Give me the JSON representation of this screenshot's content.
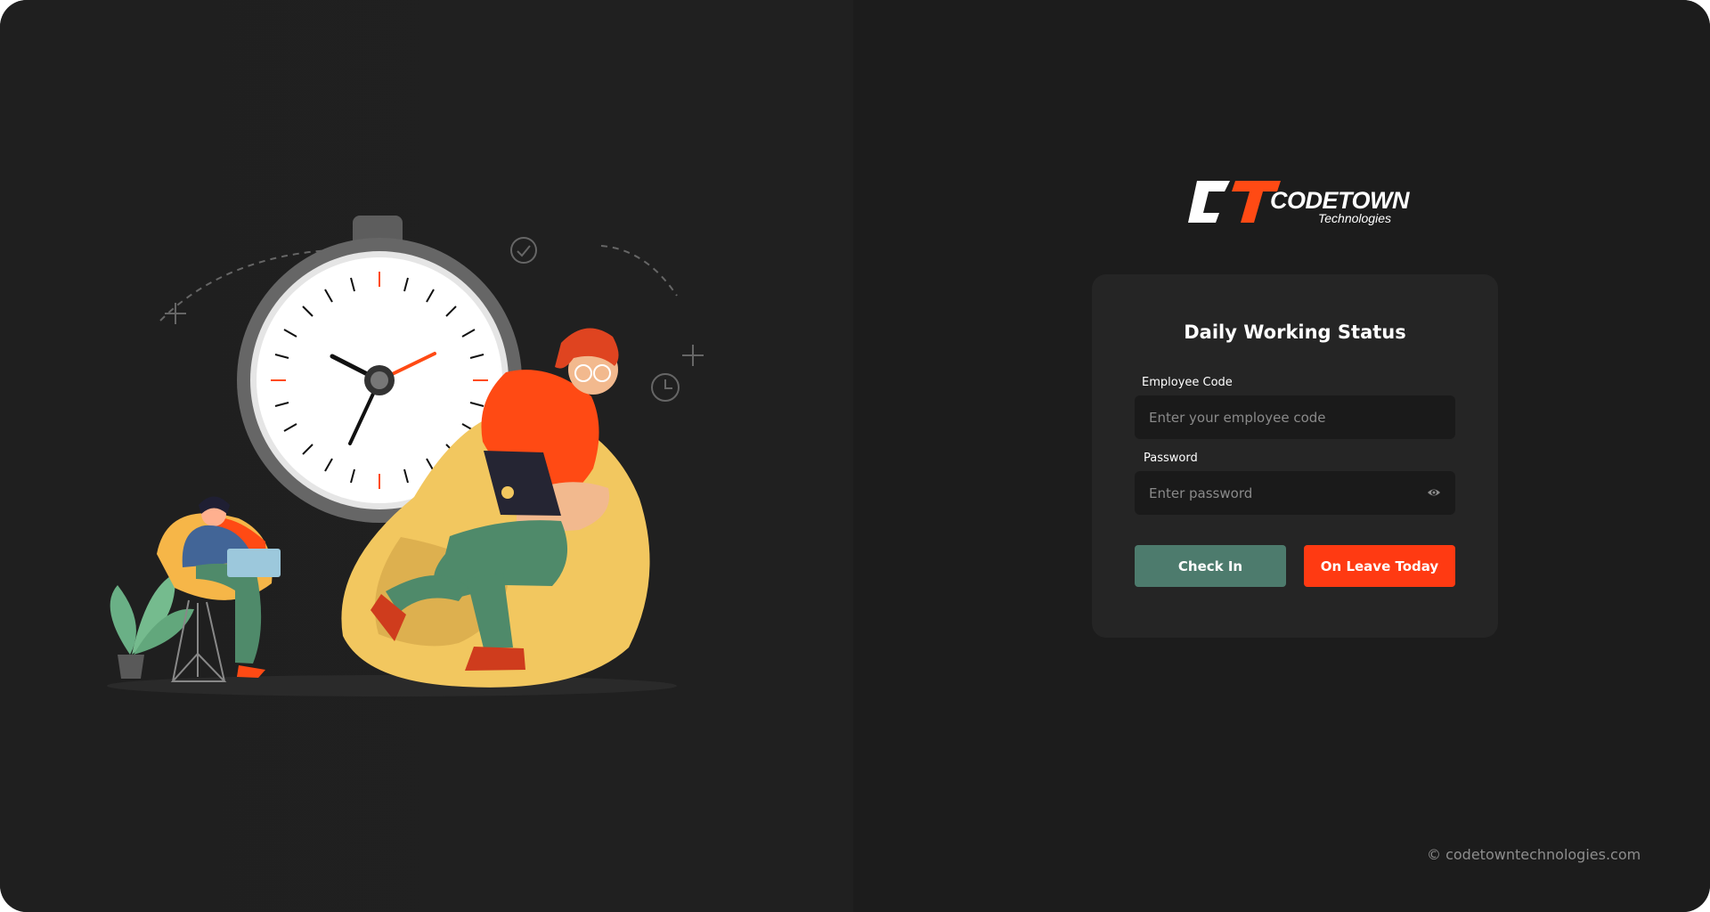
{
  "brand": {
    "name": "CODETOWN",
    "tagline": "Technologies",
    "primary_color": "#ff4a14",
    "secondary_color": "#4d7b6d"
  },
  "form": {
    "title": "Daily Working Status",
    "employee_code": {
      "label": "Employee Code",
      "value": "",
      "placeholder": "Enter your employee code"
    },
    "password": {
      "label": "Password",
      "value": "",
      "placeholder": "Enter password",
      "toggle_icon": "eye-icon"
    },
    "buttons": {
      "check_in": "Check In",
      "on_leave": "On Leave Today"
    }
  },
  "footer": {
    "copyright": "© codetowntechnologies.com"
  },
  "illustration": {
    "icons": [
      "stopwatch-icon",
      "checkmark-circle-icon",
      "clock-icon",
      "plus-sparkle-icon"
    ]
  }
}
